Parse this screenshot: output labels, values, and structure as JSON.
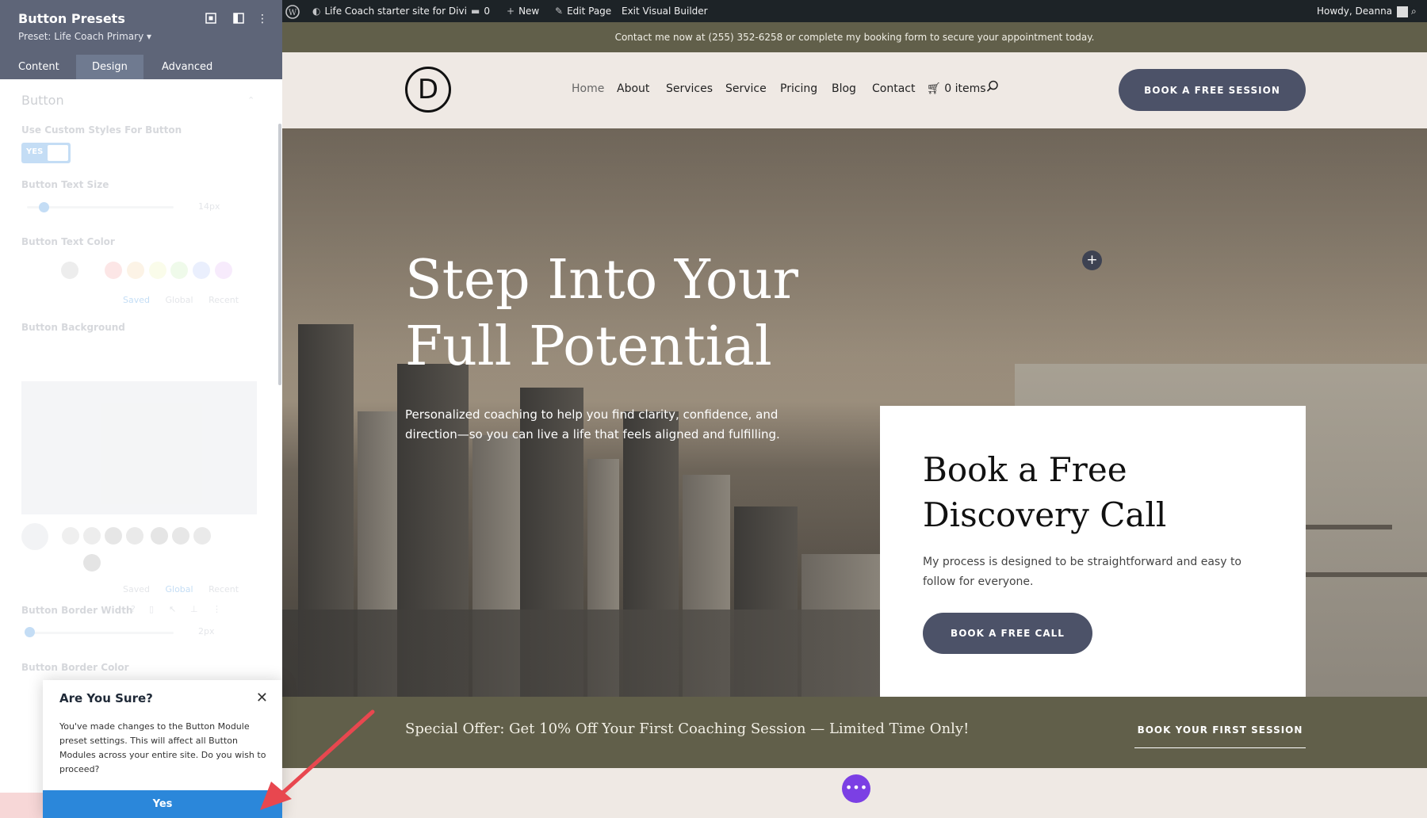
{
  "panel": {
    "title": "Button Presets",
    "preset": "Preset: Life Coach Primary ▾",
    "tabs": [
      "Content",
      "Design",
      "Advanced"
    ],
    "section_title": "Button",
    "fields": {
      "custom_styles": "Use Custom Styles For Button",
      "toggle_value": "YES",
      "text_size": "Button Text Size",
      "text_size_value": "14px",
      "text_color": "Button Text Color",
      "background": "Button Background",
      "border_width": "Button Border Width",
      "border_width_value": "2px",
      "border_color": "Button Border Color"
    },
    "color_tabs": [
      "Saved",
      "Global",
      "Recent"
    ],
    "bg_tabs": [
      "Saved",
      "Global",
      "Recent"
    ]
  },
  "dialog": {
    "title": "Are You Sure?",
    "text": "You've made changes to the Button Module preset settings. This will affect all Button Modules across your entire site. Do you wish to proceed?",
    "yes": "Yes",
    "close": "✕"
  },
  "adminbar": {
    "site": "Life Coach starter site for Divi",
    "comments": "0",
    "new": "New",
    "edit": "Edit Page",
    "exit": "Exit Visual Builder",
    "howdy": "Howdy, Deanna"
  },
  "site": {
    "topbar": "Contact me now at (255) 352-6258 or complete my booking form to secure your appointment today.",
    "logo": "D",
    "nav": [
      "Home",
      "About",
      "Services",
      "Service",
      "Pricing",
      "Blog",
      "Contact"
    ],
    "cart": "0 items",
    "cta": "BOOK A FREE SESSION",
    "hero_title_1": "Step Into Your",
    "hero_title_2": "Full Potential",
    "hero_sub": "Personalized coaching to help you find clarity, confidence, and direction—so you can live a life that feels aligned and fulfilling.",
    "card_title": "Book a Free Discovery Call",
    "card_text": "My process is designed to be straightforward and easy to follow for everyone.",
    "card_btn": "BOOK A FREE CALL",
    "offer": "Special Offer: Get 10% Off Your First Coaching Session — Limited Time Only!",
    "offer_btn": "BOOK YOUR FIRST SESSION"
  },
  "colors": {
    "builder_header": "#5e6578",
    "accent_blue": "#2b87da",
    "olive": "#615f4a",
    "button_navy": "#4c5268",
    "builder_purple": "#7b3fe4",
    "arrow_red": "#e8474f"
  }
}
